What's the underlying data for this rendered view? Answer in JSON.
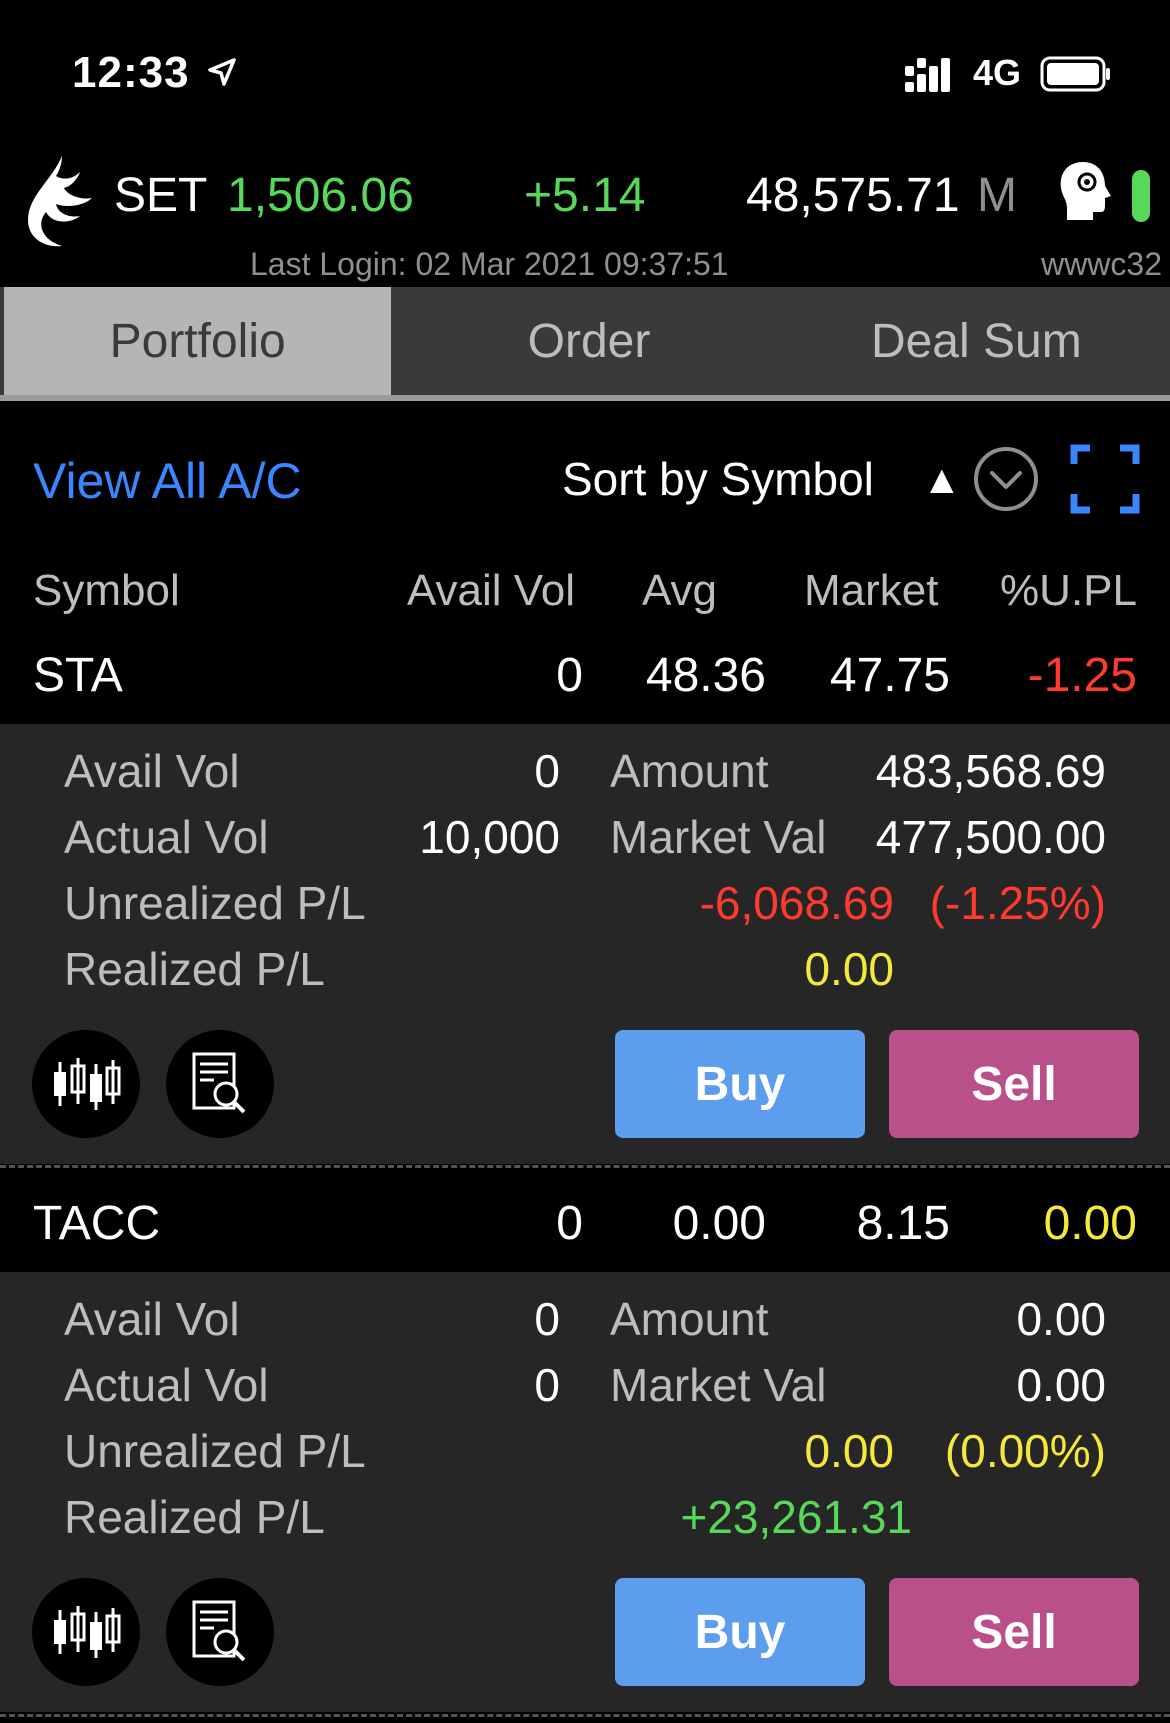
{
  "status_bar": {
    "time": "12:33",
    "network": "4G"
  },
  "market": {
    "index_name": "SET",
    "index_value": "1,506.06",
    "change": "+5.14",
    "volume": "48,575.71",
    "volume_unit": "M",
    "last_login": "Last Login: 02 Mar 2021 09:37:51",
    "user_id": "wwwc32"
  },
  "tabs": [
    {
      "label": "Portfolio",
      "active": true
    },
    {
      "label": "Order",
      "active": false
    },
    {
      "label": "Deal Sum",
      "active": false
    }
  ],
  "toolbar": {
    "view_all": "View All A/C",
    "sort_label": "Sort by Symbol",
    "sort_arrow": "▲"
  },
  "columns": [
    "Symbol",
    "Avail Vol",
    "Avg",
    "Market",
    "%U.PL"
  ],
  "labels": {
    "avail_vol": "Avail Vol",
    "actual_vol": "Actual Vol",
    "unrealized": "Unrealized P/L",
    "realized": "Realized P/L",
    "amount": "Amount",
    "market_val": "Market Val",
    "buy": "Buy",
    "sell": "Sell"
  },
  "positions": [
    {
      "symbol": "STA",
      "avail_vol": "0",
      "avg": "48.36",
      "market": "47.75",
      "upl_pct": "-1.25",
      "detail": {
        "avail_vol": "0",
        "actual_vol": "10,000",
        "amount": "483,568.69",
        "market_val": "477,500.00",
        "unrealized": "-6,068.69",
        "unrealized_pct": "(-1.25%)",
        "realized": "0.00"
      }
    },
    {
      "symbol": "TACC",
      "avail_vol": "0",
      "avg": "0.00",
      "market": "8.15",
      "upl_pct": "0.00",
      "detail": {
        "avail_vol": "0",
        "actual_vol": "0",
        "amount": "0.00",
        "market_val": "0.00",
        "unrealized": "0.00",
        "unrealized_pct": "(0.00%)",
        "realized": "+23,261.31"
      }
    }
  ],
  "colors": {
    "positive": "#57d85b",
    "negative": "#ff3b30",
    "neutral": "#f4e93b",
    "buy": "#5c9ded",
    "sell": "#b9508a",
    "link": "#3a86ff"
  }
}
